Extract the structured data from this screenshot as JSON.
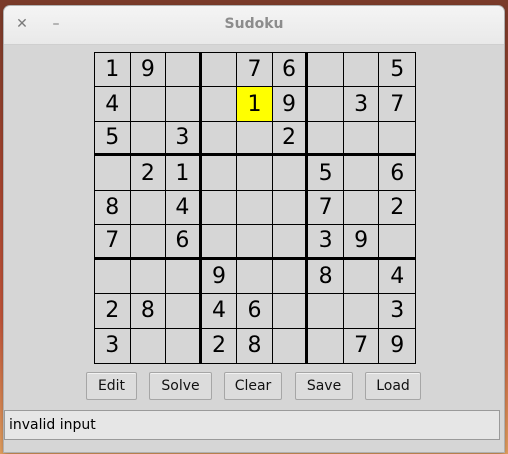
{
  "window": {
    "title": "Sudoku",
    "close_glyph": "✕",
    "minimize_glyph": "–"
  },
  "board": {
    "rows": [
      [
        "1",
        "9",
        "",
        "",
        "7",
        "6",
        "",
        "",
        "5"
      ],
      [
        "4",
        "",
        "",
        "",
        "1",
        "9",
        "",
        "3",
        "7"
      ],
      [
        "5",
        "",
        "3",
        "",
        "",
        "2",
        "",
        "",
        ""
      ],
      [
        "",
        "2",
        "1",
        "",
        "",
        "",
        "5",
        "",
        "6"
      ],
      [
        "8",
        "",
        "4",
        "",
        "",
        "",
        "7",
        "",
        "2"
      ],
      [
        "7",
        "",
        "6",
        "",
        "",
        "",
        "3",
        "9",
        ""
      ],
      [
        "",
        "",
        "",
        "9",
        "",
        "",
        "8",
        "",
        "4"
      ],
      [
        "2",
        "8",
        "",
        "4",
        "6",
        "",
        "",
        "",
        "3"
      ],
      [
        "3",
        "",
        "",
        "2",
        "8",
        "",
        "",
        "7",
        "9"
      ]
    ],
    "selected": {
      "row": 1,
      "col": 4
    },
    "highlight_color": "#ffff00"
  },
  "buttons": {
    "edit": "Edit",
    "solve": "Solve",
    "clear": "Clear",
    "save": "Save",
    "load": "Load"
  },
  "status": {
    "message": "invalid input"
  }
}
